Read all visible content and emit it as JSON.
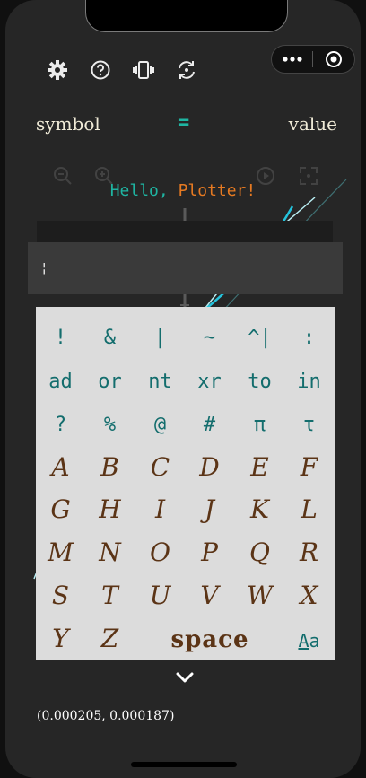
{
  "toolbar": {
    "icons": [
      "gear-icon",
      "help-icon",
      "vibrate-icon",
      "refresh-icon"
    ]
  },
  "capsule": {
    "more_icon": "•••",
    "target_icon": "record-icon"
  },
  "assignment": {
    "symbol_label": "symbol",
    "equals": "=",
    "value_label": "value"
  },
  "greeting": {
    "word1": "Hello,",
    "word2": "Plotter!"
  },
  "editor": {
    "value": "¦"
  },
  "keyboard": {
    "symbol_row1": [
      "!",
      "&",
      "|",
      "~",
      "^|",
      ":"
    ],
    "word_row": [
      "ad",
      "or",
      "nt",
      "xr",
      "to",
      "in"
    ],
    "symbol_row2": [
      "?",
      "%",
      "@",
      "#",
      "π",
      "τ"
    ],
    "letter_rows": [
      [
        "A",
        "B",
        "C",
        "D",
        "E",
        "F"
      ],
      [
        "G",
        "H",
        "I",
        "J",
        "K",
        "L"
      ],
      [
        "M",
        "N",
        "O",
        "P",
        "Q",
        "R"
      ],
      [
        "S",
        "T",
        "U",
        "V",
        "W",
        "X"
      ],
      [
        "Y",
        "Z"
      ]
    ],
    "space_label": "space",
    "case_upper": "A",
    "case_lower": "a"
  },
  "coordinates": "(0.000205, 0.000187)",
  "colors": {
    "accent_teal": "#1fb5a2",
    "accent_orange": "#e67a22",
    "key_teal": "#136d6d",
    "key_brown": "#5b3416",
    "curve_cyan": "#24c3dc"
  }
}
